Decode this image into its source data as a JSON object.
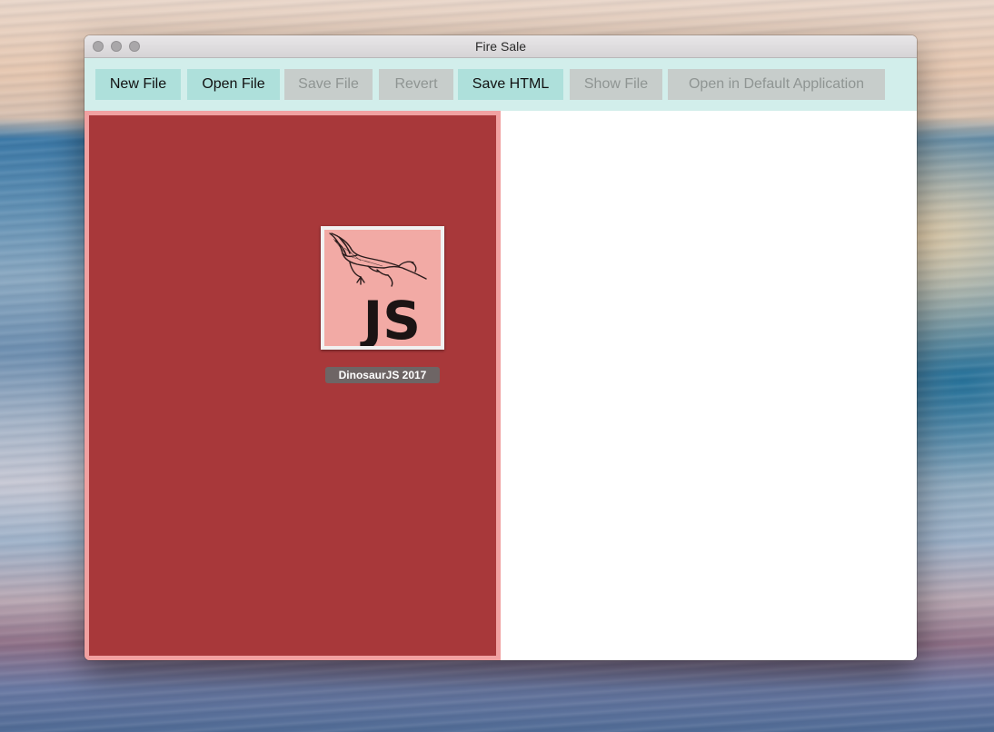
{
  "window": {
    "title": "Fire Sale"
  },
  "toolbar": {
    "buttons": [
      {
        "label": "New File",
        "enabled": true
      },
      {
        "label": "Open File",
        "enabled": true
      },
      {
        "label": "Save File",
        "enabled": false
      },
      {
        "label": "Revert",
        "enabled": false
      },
      {
        "label": "Save HTML",
        "enabled": true
      },
      {
        "label": "Show File",
        "enabled": false
      },
      {
        "label": "Open in Default Application",
        "enabled": false
      }
    ]
  },
  "editor": {
    "file_icon": {
      "name": "DinosaurJS 2017",
      "logo_text": "JS",
      "icon": "pterodactyl-js-logo-icon"
    }
  },
  "colors": {
    "toolbar_bg": "#d2eeeb",
    "button_enabled": "#aee0db",
    "button_disabled": "#c7cdcb",
    "editor_bg": "#a8383a",
    "editor_border": "#f1a1a1",
    "preview_bg": "#ffffff",
    "logo_bg": "#f2aaa5"
  }
}
